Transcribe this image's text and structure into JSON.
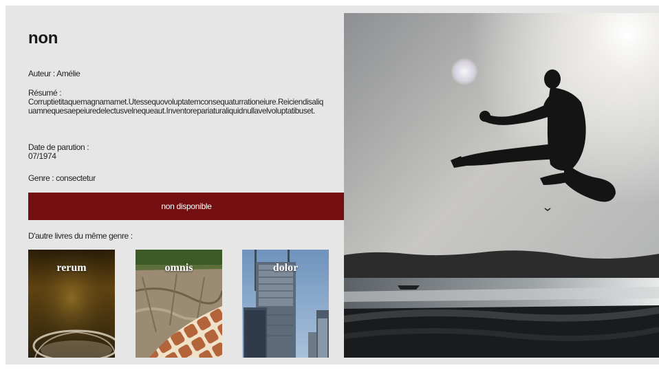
{
  "book": {
    "title": "non",
    "author_label": "Auteur :",
    "author": "Amélie",
    "summary_label": "Résumé :",
    "summary": "Corruptietitaquemagnamamet.Utessequovoluptatemconsequaturrationeiure.Reiciendisaliquamnequesaepeiuredelectusvelnequeaut.Inventorepariaturaliquidnullavelvoluptatibuset.",
    "date_label": "Date de parution :",
    "date": "07/1974",
    "genre_label": "Genre :",
    "genre": "consectetur",
    "status": "non disponible"
  },
  "related": {
    "heading": "D'autre livres du même genre :",
    "items": [
      {
        "title": "rerum",
        "image_icon": "glass-photo"
      },
      {
        "title": "omnis",
        "image_icon": "rock-giraffe-photo"
      },
      {
        "title": "dolor",
        "image_icon": "skyscraper-photo"
      }
    ]
  },
  "hero": {
    "image_icon": "martial-arts-jump-photo"
  },
  "colors": {
    "panel_background": "#e6e6e6",
    "status_bar": "#730f10",
    "text": "#222222"
  }
}
